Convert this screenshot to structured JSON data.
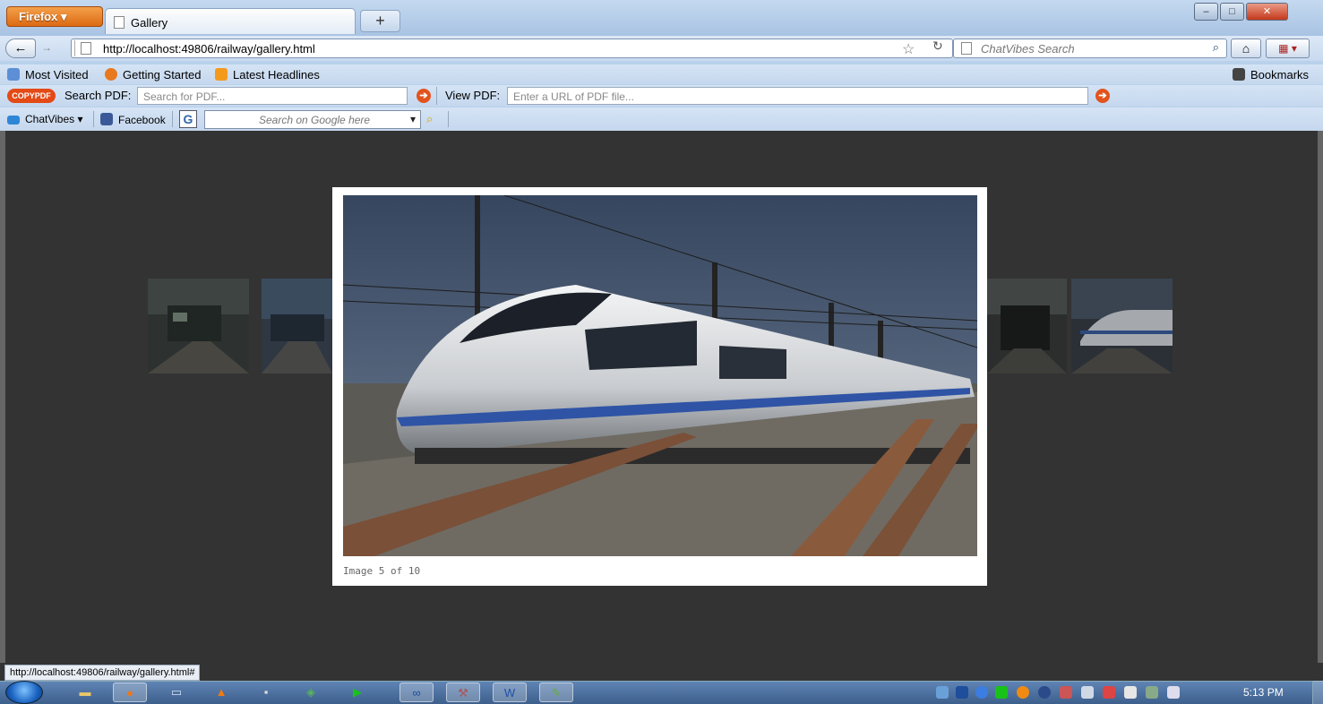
{
  "browser": {
    "menu_label": "Firefox ▾",
    "tab_title": "Gallery",
    "new_tab_label": "+",
    "url": "http://localhost:49806/railway/gallery.html",
    "search_placeholder": "ChatVibes Search",
    "window_controls": {
      "minimize": "–",
      "maximize": "□",
      "close": "✕"
    },
    "star_icon": "☆",
    "reload_icon": "↻"
  },
  "bookmarks_bar": {
    "items": [
      "Most Visited",
      "Getting Started",
      "Latest Headlines"
    ],
    "right_label": "Bookmarks"
  },
  "pdf_toolbar": {
    "logo": "COPYPDF",
    "search_label": "Search PDF:",
    "search_placeholder": "Search for PDF...",
    "view_label": "View PDF:",
    "view_placeholder": "Enter a URL of PDF file..."
  },
  "chatvibes_toolbar": {
    "chatvibes_label": "ChatVibes ▾",
    "facebook_label": "Facebook",
    "google_placeholder": "Search on Google here"
  },
  "gallery": {
    "caption": "Image 5 of 10",
    "current_index": 5,
    "total": 10
  },
  "status_bar": {
    "text": "http://localhost:49806/railway/gallery.html#"
  },
  "taskbar": {
    "clock": "5:13 PM"
  },
  "colors": {
    "page_background": "#333333",
    "accent_orange": "#e2531d",
    "firefox_button": "#e8791f"
  }
}
